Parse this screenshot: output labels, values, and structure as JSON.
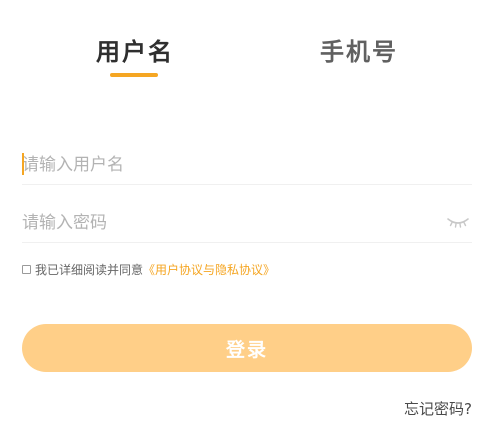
{
  "tabs": [
    {
      "label": "用户名",
      "active": true
    },
    {
      "label": "手机号",
      "active": false
    }
  ],
  "username_field": {
    "placeholder": "请输入用户名",
    "value": ""
  },
  "password_field": {
    "placeholder": "请输入密码",
    "value": "",
    "toggle_icon": "eye-closed-icon"
  },
  "agreement": {
    "checked": false,
    "prefix": "我已详细阅读并同意",
    "link": "《用户协议与隐私协议》"
  },
  "login_button": {
    "label": "登录"
  },
  "forgot_password": {
    "label": "忘记密码?"
  },
  "colors": {
    "accent": "#f5a623",
    "button_bg": "#ffcf88",
    "placeholder": "#b3b3b3"
  }
}
